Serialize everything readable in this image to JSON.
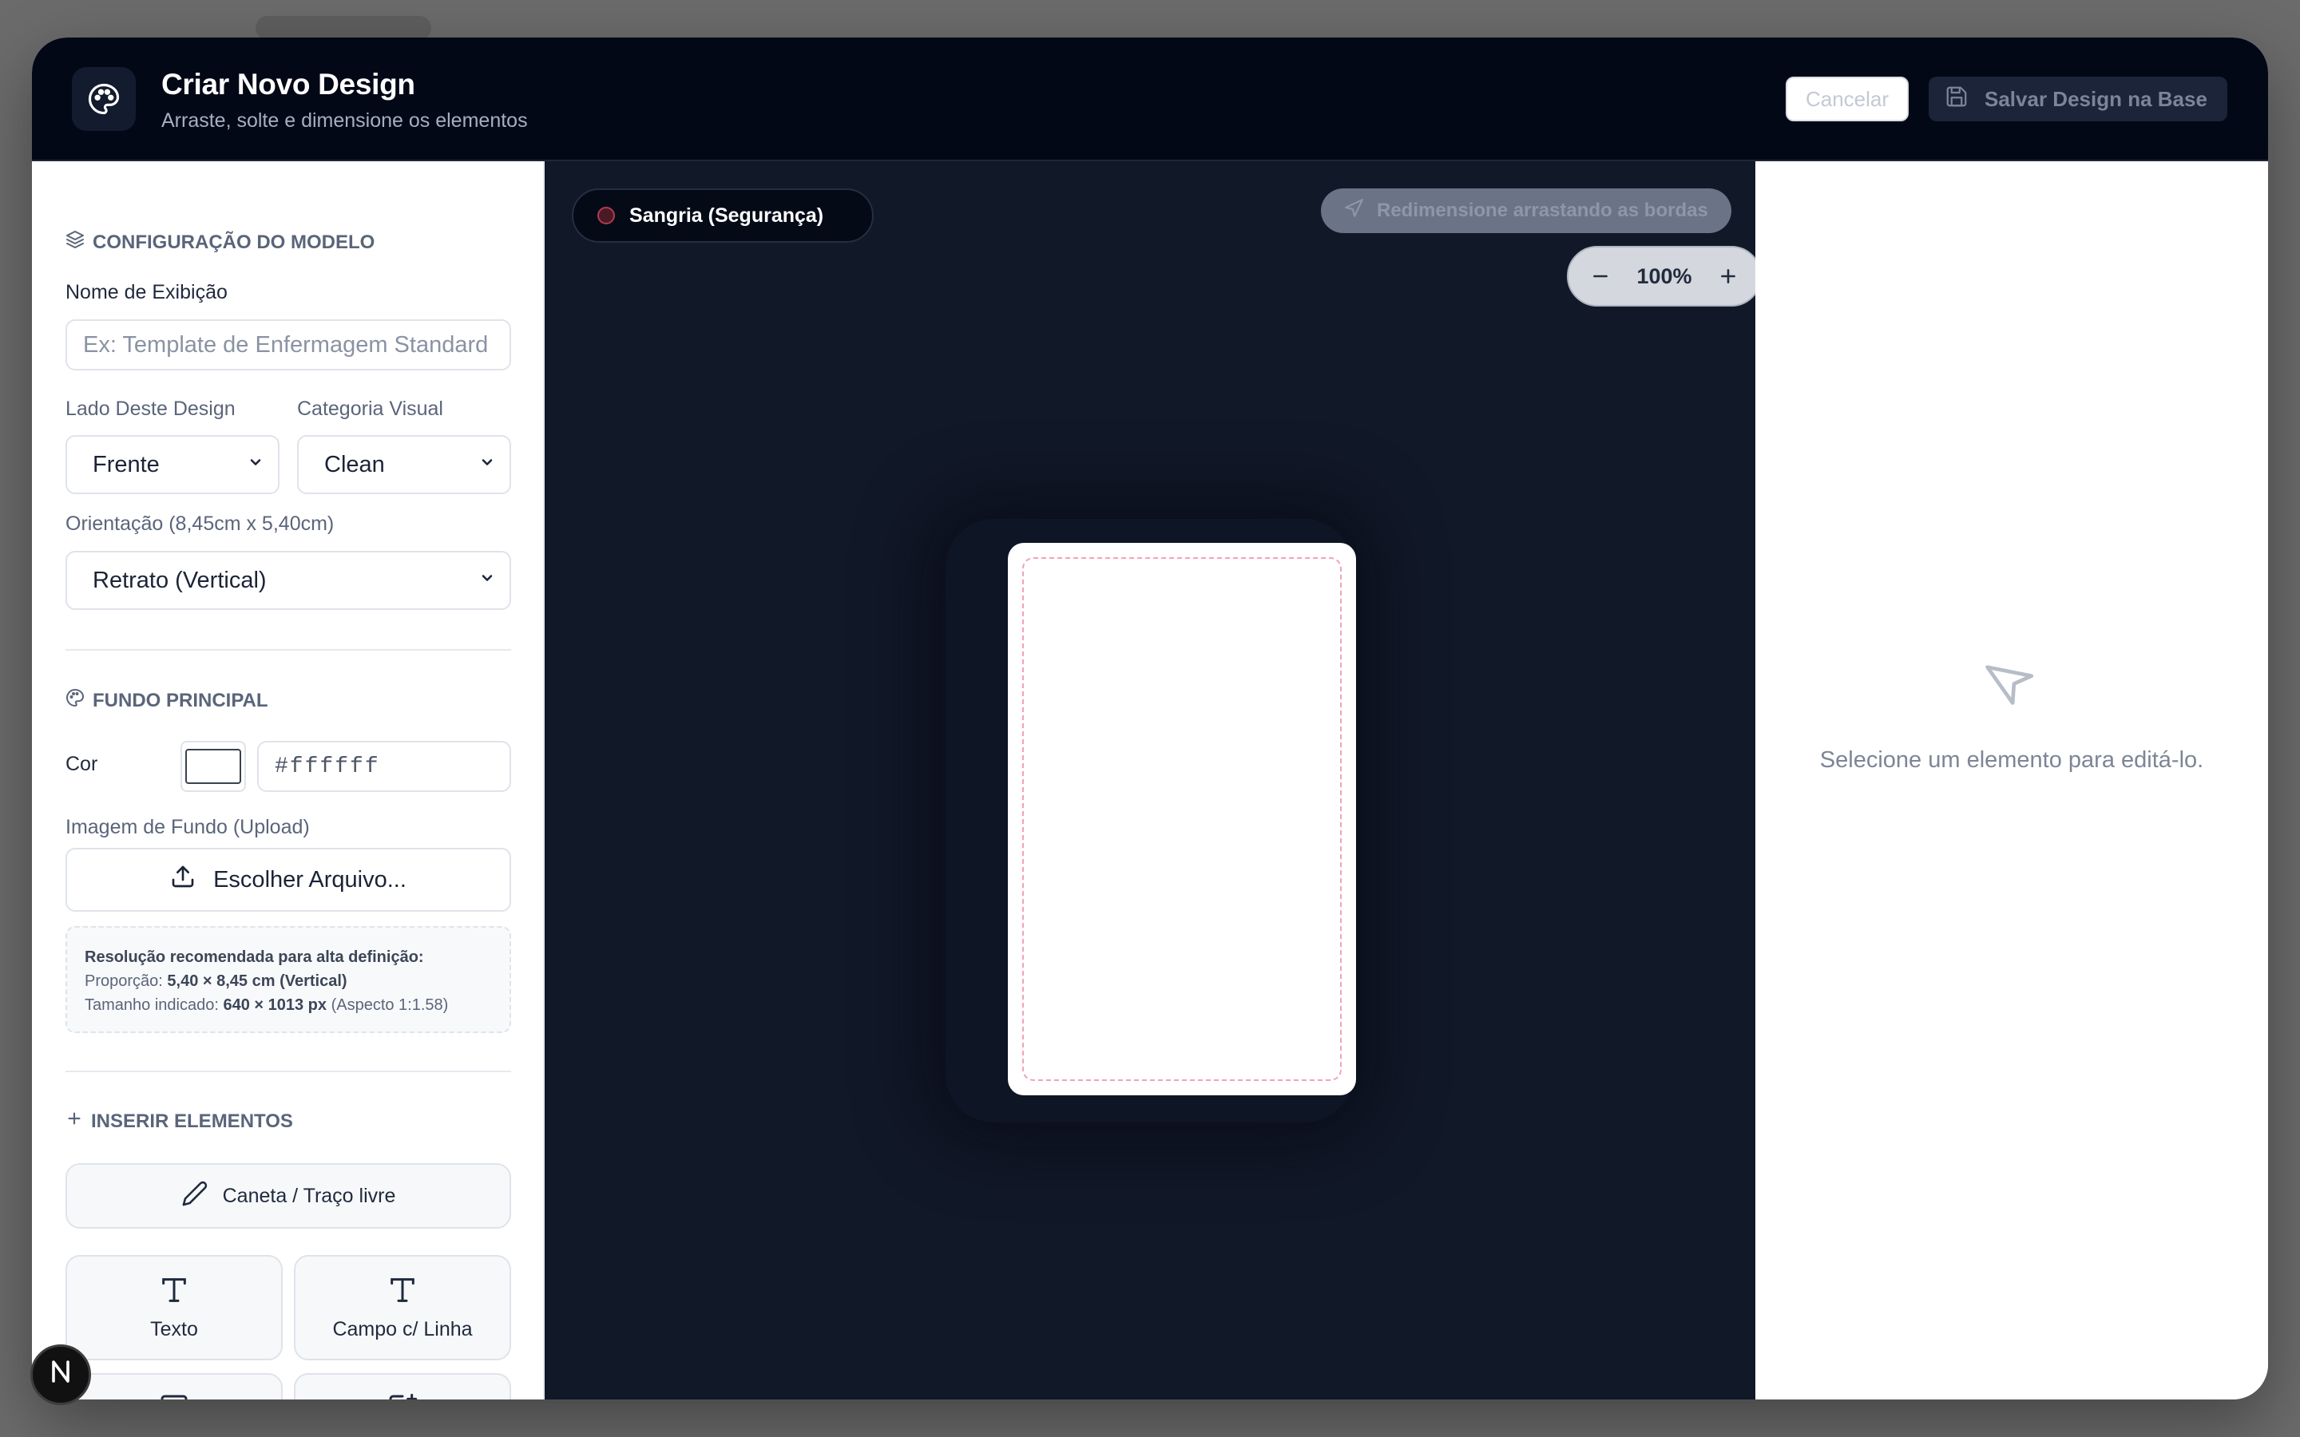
{
  "header": {
    "title": "Criar Novo Design",
    "subtitle": "Arraste, solte e dimensione os elementos",
    "cancel_label": "Cancelar",
    "save_label": "Salvar Design na Base",
    "icon": "palette-icon"
  },
  "sidebar": {
    "model_section": {
      "title": "CONFIGURAÇÃO DO MODELO",
      "icon": "layers-icon",
      "name_label": "Nome de Exibição",
      "name_placeholder": "Ex: Template de Enfermagem Standard",
      "side_label": "Lado Deste Design",
      "side_value": "Frente",
      "category_label": "Categoria Visual",
      "category_value": "Clean",
      "orientation_label": "Orientação (8,45cm x 5,40cm)",
      "orientation_value": "Retrato (Vertical)"
    },
    "background_section": {
      "title": "FUNDO PRINCIPAL",
      "icon": "palette-icon",
      "color_label": "Cor",
      "color_value": "#ffffff",
      "image_label": "Imagem de Fundo (Upload)",
      "upload_label": "Escolher Arquivo...",
      "info_title": "Resolução recomendada para alta definição:",
      "info_ratio_prefix": "Proporção:",
      "info_ratio_value": "5,40 × 8,45 cm (Vertical)",
      "info_size_prefix": "Tamanho indicado:",
      "info_size_value": "640 × 1013 px",
      "info_size_suffix": "(Aspecto 1:1.58)"
    },
    "insert_section": {
      "title": "INSERIR ELEMENTOS",
      "icon": "plus-icon",
      "pen_label": "Caneta / Traço livre",
      "text_label": "Texto",
      "field_label": "Campo c/ Linha"
    }
  },
  "canvas": {
    "bleed_label": "Sangria (Segurança)",
    "hint_label": "Redimensione arrastando as bordas",
    "zoom_value": "100%"
  },
  "inspector": {
    "empty_text": "Selecione um elemento para editá-lo."
  },
  "colors": {
    "header_bg": "#030817",
    "canvas_bg": "#111827",
    "safe_zone": "#f2a3b3"
  }
}
